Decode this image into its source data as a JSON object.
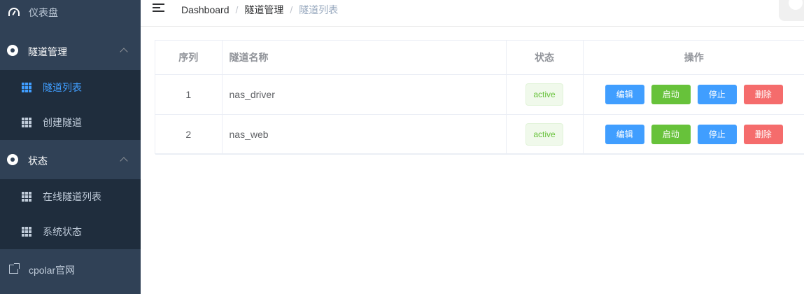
{
  "sidebar": {
    "dashboard": {
      "label": "仪表盘",
      "icon": "gauge-icon"
    },
    "tunnel_mgmt": {
      "label": "隧道管理",
      "icon": "circle-icon",
      "items": [
        {
          "label": "隧道列表",
          "icon": "grid-icon",
          "active": true
        },
        {
          "label": "创建隧道",
          "icon": "grid-icon",
          "active": false
        }
      ]
    },
    "status": {
      "label": "状态",
      "icon": "circle-icon",
      "items": [
        {
          "label": "在线隧道列表",
          "icon": "grid-icon"
        },
        {
          "label": "系统状态",
          "icon": "grid-icon"
        }
      ]
    },
    "external": {
      "label": "cpolar官网",
      "icon": "external-link-icon"
    }
  },
  "breadcrumb": {
    "items": [
      "Dashboard",
      "隧道管理",
      "隧道列表"
    ],
    "separator": "/"
  },
  "table": {
    "headers": [
      "序列",
      "隧道名称",
      "状态",
      "操作"
    ],
    "rows": [
      {
        "index": "1",
        "name": "nas_driver",
        "status": "active"
      },
      {
        "index": "2",
        "name": "nas_web",
        "status": "active"
      }
    ],
    "actions": {
      "edit": "编辑",
      "start": "启动",
      "stop": "停止",
      "delete": "删除"
    }
  },
  "colors": {
    "sidebar_bg": "#304156",
    "submenu_bg": "#1f2d3d",
    "primary": "#409eff",
    "success": "#67c23a",
    "danger": "#f56c6c"
  }
}
